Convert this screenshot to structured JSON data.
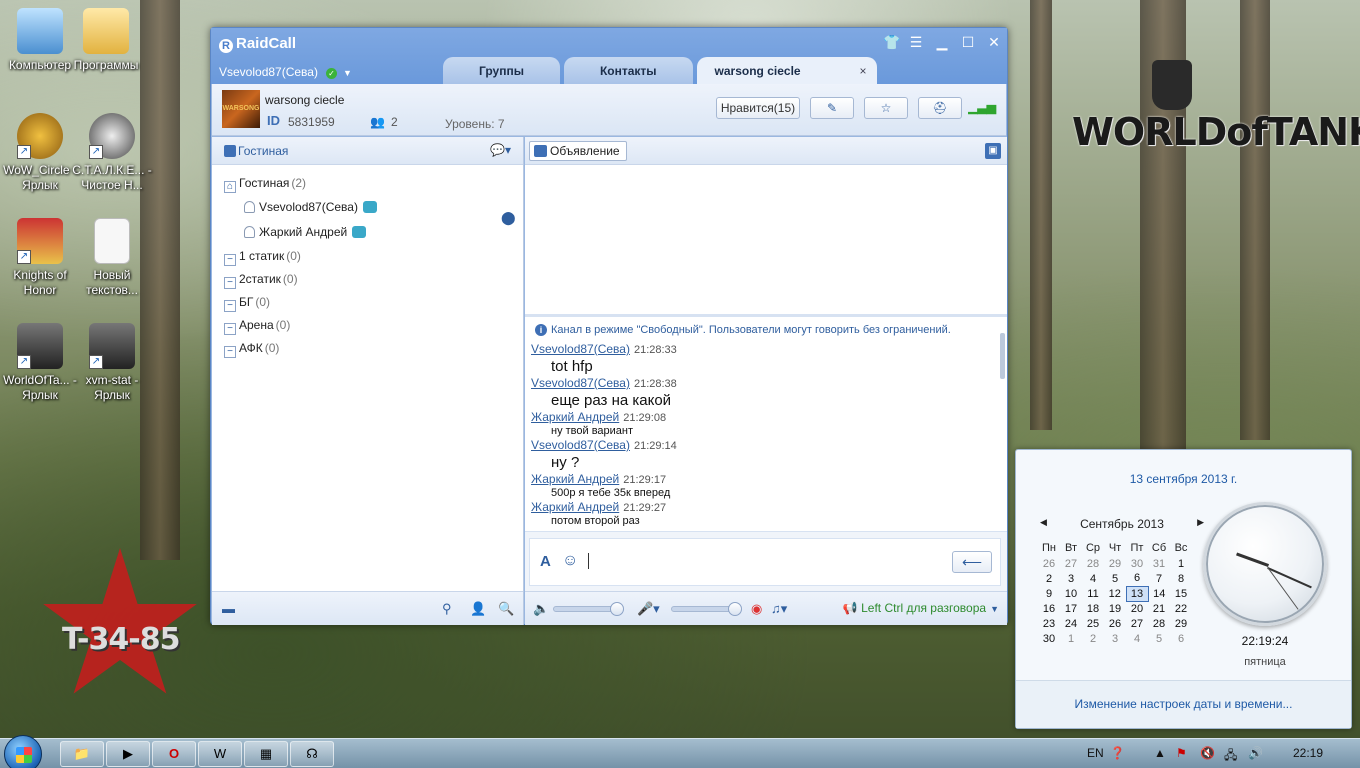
{
  "desktop": {
    "icons": [
      {
        "label": "Компьютер"
      },
      {
        "label": "Программы"
      },
      {
        "label": "WoW_Circle - Ярлык"
      },
      {
        "label": "С.Т.А.Л.К.Е... - Чистое Н..."
      },
      {
        "label": "Knights of Honor"
      },
      {
        "label": "Новый текстов..."
      },
      {
        "label": "WorldOfTa... - Ярлык"
      },
      {
        "label": "xvm-stat - Ярлык"
      }
    ],
    "wallpaper_logo": "WORLDofTANKS",
    "star_text": "T-34-85"
  },
  "raidcall": {
    "app_title": "RaidCall",
    "username": "Vsevolod87(Сева)",
    "tabs": [
      {
        "label": "Группы"
      },
      {
        "label": "Контакты"
      },
      {
        "label": "warsong ciecle"
      }
    ],
    "group": {
      "avatar_text": "WARSONG",
      "name": "warsong ciecle",
      "id_label": "ID",
      "id": "5831959",
      "members": "2",
      "level": "Уровень: 7",
      "like_button": "Нравится(15)"
    },
    "left_pane": {
      "title": "Гостиная",
      "channels": [
        {
          "name": "Гостиная",
          "count": "(2)"
        },
        {
          "name": "1 статик",
          "count": "(0)"
        },
        {
          "name": "2статик",
          "count": "(0)"
        },
        {
          "name": "БГ",
          "count": "(0)"
        },
        {
          "name": "Арена",
          "count": "(0)"
        },
        {
          "name": "АФК",
          "count": "(0)"
        }
      ],
      "users": [
        {
          "name": "Vsevolod87(Сева)"
        },
        {
          "name": "Жаркий Андрей"
        }
      ]
    },
    "announcement": {
      "button_label": "Объявление"
    },
    "chat": {
      "system_message": "Канал в режиме \"Свободный\". Пользователи могут говорить без ограничений.",
      "messages": [
        {
          "user": "Vsevolod87(Сева)",
          "time": "21:28:33",
          "text": "tot hfp"
        },
        {
          "user": "Vsevolod87(Сева)",
          "time": "21:28:38",
          "text": "еще раз на какой"
        },
        {
          "user": "Жаркий Андрей",
          "time": "21:29:08",
          "text": "ну твой вариант"
        },
        {
          "user": "Vsevolod87(Сева)",
          "time": "21:29:14",
          "text": "ну ?"
        },
        {
          "user": "Жаркий Андрей",
          "time": "21:29:17",
          "text": "500р я тебе 35к вперед"
        },
        {
          "user": "Жаркий Андрей",
          "time": "21:29:27",
          "text": "потом второй раз"
        }
      ]
    },
    "voice": {
      "push_to_talk": "Left Ctrl для разговора",
      "speaker_volume": 0.9,
      "mic_volume": 0.9
    }
  },
  "calendar": {
    "full_date": "13 сентября 2013 г.",
    "month_label": "Сентябрь 2013",
    "weekdays": [
      "Пн",
      "Вт",
      "Ср",
      "Чт",
      "Пт",
      "Сб",
      "Вс"
    ],
    "weeks": [
      [
        "26",
        "27",
        "28",
        "29",
        "30",
        "31",
        "1"
      ],
      [
        "2",
        "3",
        "4",
        "5",
        "6",
        "7",
        "8"
      ],
      [
        "9",
        "10",
        "11",
        "12",
        "13",
        "14",
        "15"
      ],
      [
        "16",
        "17",
        "18",
        "19",
        "20",
        "21",
        "22"
      ],
      [
        "23",
        "24",
        "25",
        "26",
        "27",
        "28",
        "29"
      ],
      [
        "30",
        "1",
        "2",
        "3",
        "4",
        "5",
        "6"
      ]
    ],
    "today": "13",
    "time": "22:19:24",
    "weekday": "пятница",
    "settings_link": "Изменение настроек даты и времени..."
  },
  "taskbar": {
    "language": "EN",
    "clock": "22:19"
  }
}
